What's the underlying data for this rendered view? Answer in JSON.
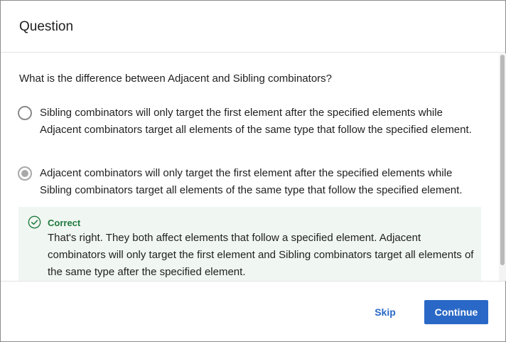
{
  "dialog": {
    "title": "Question"
  },
  "question": {
    "text": "What is the difference between Adjacent and Sibling combinators?",
    "options": [
      {
        "label": "Sibling combinators will only target the first element after the specified elements while Adjacent combinators target all elements of the same type that follow the specified element.",
        "selected": false
      },
      {
        "label": "Adjacent combinators will only target the first element after the specified elements while Sibling combinators target all elements of the same type that follow the specified element.",
        "selected": true
      }
    ]
  },
  "feedback": {
    "icon": "check-circle-icon",
    "status": "Correct",
    "text": "That's right. They both affect elements that follow a specified element. Adjacent combinators will only target the first element and Sibling combinators target all elements of the same type after the specified element.",
    "color": "#1e7a3e"
  },
  "footer": {
    "skip_label": "Skip",
    "continue_label": "Continue",
    "accent_color": "#2a68c7"
  }
}
